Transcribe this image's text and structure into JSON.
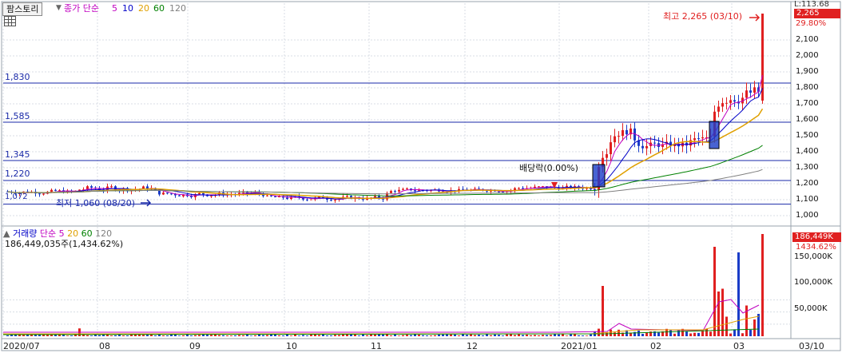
{
  "toolbar": {
    "stock_name": "팜스토리",
    "dropdown_glyph": "▼",
    "price_label": "종가 단순",
    "ma_periods": [
      "5",
      "10",
      "20",
      "60",
      "120"
    ],
    "ma_colors": [
      "#c000c0",
      "#0000c8",
      "#e0a000",
      "#008000",
      "#808080"
    ]
  },
  "volume_header": {
    "label": "거래량",
    "ma_label": "단순",
    "ma_periods": [
      "5",
      "20",
      "60",
      "120"
    ],
    "total": "186,449,035주(1,434.62%)"
  },
  "price_axis": {
    "top_label": "L:113.68",
    "current_tag": "2,265",
    "change_pct": "29.80%",
    "ticks": [
      "2,100",
      "2,000",
      "1,900",
      "1,800",
      "1,700",
      "1,600",
      "1,500",
      "1,400",
      "1,300",
      "1,200",
      "1,100",
      "1,000"
    ]
  },
  "volume_axis": {
    "current_tag": "186,449K",
    "pct": "1434.62%",
    "ticks": [
      "150,000K",
      "100,000K",
      "50,000K"
    ]
  },
  "horizontal_lines": [
    "1,830",
    "1,585",
    "1,345",
    "1,220"
  ],
  "left_edge_label": "1,072",
  "annotations": {
    "high": "최고 2,265 (03/10)",
    "low": "최저 1,060 (08/20)",
    "dividend": "배당락(0.00%)"
  },
  "x_axis": [
    "2020/07",
    "08",
    "09",
    "10",
    "11",
    "12",
    "2021/01",
    "02",
    "03",
    "03/10"
  ],
  "colors": {
    "up": "#e02020",
    "down": "#1a3cc8",
    "hline": "#1a2aa8",
    "grid": "#d8dde4",
    "highlight_fill": "#1a3cc8"
  },
  "chart_data": {
    "type": "candlestick",
    "date_range": [
      "2020/07",
      "03/10"
    ],
    "y_unit": "KRW",
    "horizontal_levels": [
      1830,
      1585,
      1345,
      1220
    ],
    "high": {
      "value": 2265,
      "date": "03/10"
    },
    "low": {
      "value": 1060,
      "date": "08/20"
    },
    "price_series": [
      {
        "period": "2020/07",
        "close": 1150
      },
      {
        "period": "08",
        "close": 1170
      },
      {
        "period": "09",
        "close": 1140
      },
      {
        "period": "10",
        "close": 1125
      },
      {
        "period": "11",
        "close": 1160
      },
      {
        "period": "12",
        "close": 1180
      },
      {
        "period": "2021/01",
        "close": 1500
      },
      {
        "period": "02",
        "close": 1470
      },
      {
        "period": "03",
        "close": 1790
      },
      {
        "period": "03/10",
        "close": 2265
      }
    ],
    "volume_last": "186,449K"
  }
}
